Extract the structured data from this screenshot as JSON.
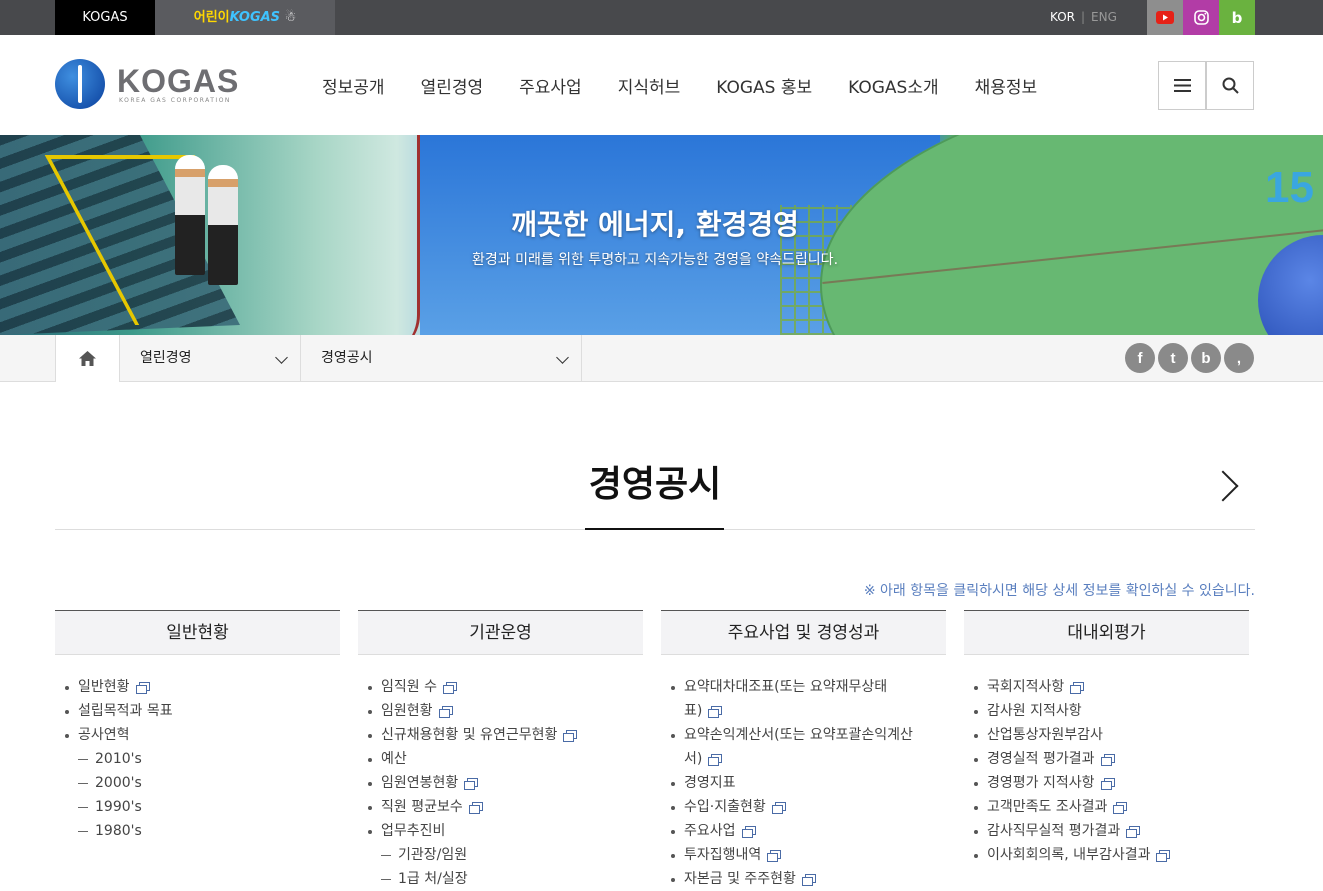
{
  "topbar": {
    "kogas": "KOGAS",
    "kids_prefix": "어린이",
    "kids_brand": "KOGAS",
    "lang_kor": "KOR",
    "lang_sep": "|",
    "lang_eng": "ENG",
    "sns_blog": "b"
  },
  "logo": {
    "text": "KOGAS",
    "sub": "KOREA GAS CORPORATION"
  },
  "nav": [
    "정보공개",
    "열린경영",
    "주요사업",
    "지식허브",
    "KOGAS 홍보",
    "KOGAS소개",
    "채용정보"
  ],
  "visual": {
    "title": "깨끗한 에너지, 환경경영",
    "subtitle": "환경과 미래를 위한 투명하고 지속가능한 경영을 약속드립니다.",
    "tank_number": "15"
  },
  "location": {
    "depth1": "열린경영",
    "depth2": "경영공시"
  },
  "share": {
    "facebook": "f",
    "twitter": "t",
    "blog": "b",
    "kakao": ","
  },
  "page_title": "경영공시",
  "notice": "※ 아래 항목을 클릭하시면 해당 상세 정보를 확인하실 수 있습니다.",
  "columns": [
    {
      "title": "일반현황",
      "items": [
        {
          "t": "li",
          "text": "일반현황",
          "win": true
        },
        {
          "t": "li",
          "text": "설립목적과 목표"
        },
        {
          "t": "li",
          "text": "공사연혁"
        },
        {
          "t": "sub",
          "text": "2010's"
        },
        {
          "t": "sub",
          "text": "2000's"
        },
        {
          "t": "sub",
          "text": "1990's"
        },
        {
          "t": "sub",
          "text": "1980's"
        }
      ]
    },
    {
      "title": "기관운영",
      "items": [
        {
          "t": "li",
          "text": "임직원 수",
          "win": true
        },
        {
          "t": "li",
          "text": "임원현황",
          "win": true
        },
        {
          "t": "li",
          "text": "신규채용현황 및 유연근무현황",
          "win": true
        },
        {
          "t": "li",
          "text": "예산"
        },
        {
          "t": "li",
          "text": "임원연봉현황",
          "win": true
        },
        {
          "t": "li",
          "text": "직원 평균보수",
          "win": true
        },
        {
          "t": "li",
          "text": "업무추진비"
        },
        {
          "t": "sub",
          "text": "기관장/임원"
        },
        {
          "t": "sub",
          "text": "1급 처/실장"
        }
      ]
    },
    {
      "title": "주요사업 및 경영성과",
      "items": [
        {
          "t": "li",
          "text": "요약대차대조표(또는 요약재무상태",
          "cont": "표)",
          "win": true
        },
        {
          "t": "li",
          "text": "요약손익계산서(또는 요약포괄손익계산",
          "cont": "서)",
          "win": true
        },
        {
          "t": "li",
          "text": "경영지표"
        },
        {
          "t": "li",
          "text": "수입·지출현황",
          "win": true
        },
        {
          "t": "li",
          "text": "주요사업",
          "win": true
        },
        {
          "t": "li",
          "text": "투자집행내역",
          "win": true
        },
        {
          "t": "li",
          "text": "자본금 및 주주현황",
          "win": true
        }
      ]
    },
    {
      "title": "대내외평가",
      "items": [
        {
          "t": "li",
          "text": "국회지적사항",
          "win": true
        },
        {
          "t": "li",
          "text": "감사원 지적사항"
        },
        {
          "t": "li",
          "text": "산업통상자원부감사"
        },
        {
          "t": "li",
          "text": "경영실적 평가결과",
          "win": true
        },
        {
          "t": "li",
          "text": "경영평가 지적사항",
          "win": true
        },
        {
          "t": "li",
          "text": "고객만족도 조사결과",
          "win": true
        },
        {
          "t": "li",
          "text": "감사직무실적 평가결과",
          "win": true
        },
        {
          "t": "li",
          "text": "이사회회의록, 내부감사결과",
          "win": true
        }
      ]
    }
  ]
}
